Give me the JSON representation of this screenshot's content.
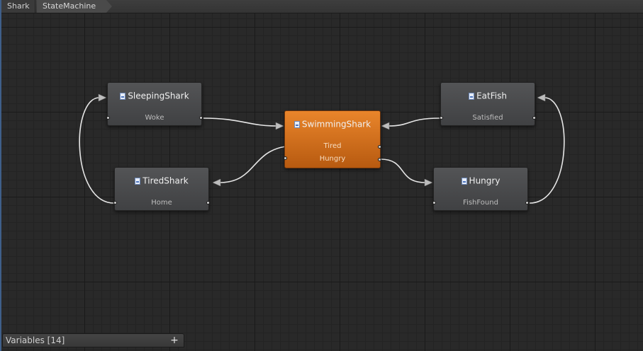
{
  "breadcrumbs": [
    "Shark",
    "StateMachine"
  ],
  "nodes": {
    "sleeping": {
      "title": "SleepingShark",
      "outputs": [
        "Woke"
      ]
    },
    "swimming": {
      "title": "SwimmingShark",
      "outputs": [
        "Tired",
        "Hungry"
      ],
      "active": true
    },
    "eat": {
      "title": "EatFish",
      "outputs": [
        "Satisfied"
      ]
    },
    "tired": {
      "title": "TiredShark",
      "outputs": [
        "Home"
      ]
    },
    "hungry": {
      "title": "Hungry",
      "outputs": [
        "FishFound"
      ]
    }
  },
  "variables_panel": {
    "label": "Variables [14]",
    "add_label": "+"
  },
  "colors": {
    "canvas": "#292929",
    "node": "#4a4b4d",
    "active_node": "#d57221",
    "edge": "#e6e6e6"
  }
}
